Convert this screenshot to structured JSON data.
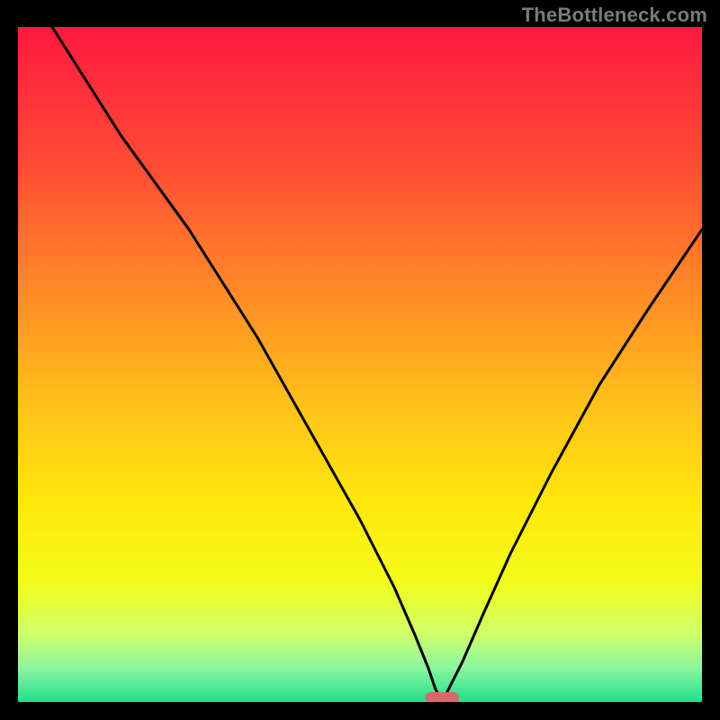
{
  "watermark": "TheBottleneck.com",
  "chart_data": {
    "type": "line",
    "title": "",
    "xlabel": "",
    "ylabel": "",
    "xlim": [
      0,
      100
    ],
    "ylim": [
      0,
      100
    ],
    "background": {
      "gradient_type": "vertical",
      "stops": [
        {
          "pos": 0.0,
          "color": "#ff193f"
        },
        {
          "pos": 0.2,
          "color": "#ff4a35"
        },
        {
          "pos": 0.4,
          "color": "#ff8d27"
        },
        {
          "pos": 0.55,
          "color": "#ffbe1b"
        },
        {
          "pos": 0.7,
          "color": "#ffe60c"
        },
        {
          "pos": 0.82,
          "color": "#f3fc19"
        },
        {
          "pos": 0.9,
          "color": "#cfff6a"
        },
        {
          "pos": 0.95,
          "color": "#8af5a0"
        },
        {
          "pos": 1.0,
          "color": "#1fe08b"
        }
      ]
    },
    "series": [
      {
        "name": "bottleneck-curve",
        "x": [
          5,
          10,
          15,
          20,
          25,
          30,
          35,
          40,
          45,
          50,
          55,
          58,
          60,
          61,
          62,
          63,
          65,
          68,
          72,
          78,
          85,
          92,
          100
        ],
        "y": [
          100,
          92,
          84,
          77,
          70,
          62,
          54,
          45,
          36,
          27,
          17,
          10,
          5,
          2,
          0,
          2,
          6,
          13,
          22,
          34,
          47,
          58,
          70
        ]
      }
    ],
    "marker": {
      "name": "optimal-point",
      "x": 62,
      "y": 0,
      "color": "#d66a6a"
    }
  }
}
